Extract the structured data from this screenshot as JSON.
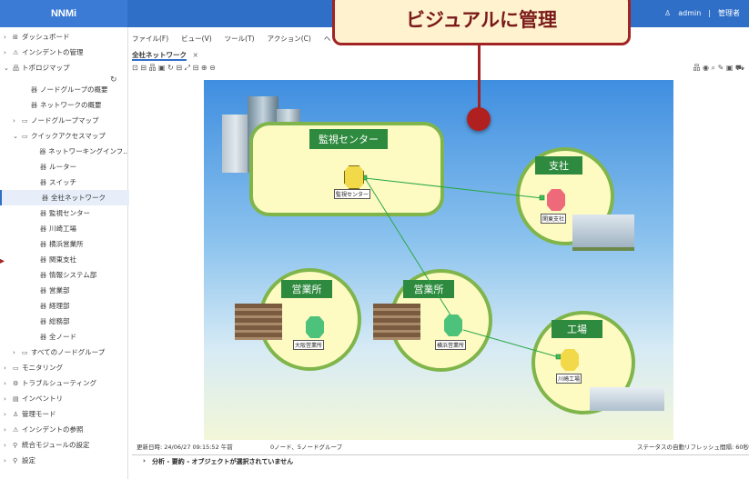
{
  "header": {
    "brand": "NNMi",
    "user": "admin",
    "separator": "|",
    "role": "管理者"
  },
  "sidebar": {
    "items": [
      {
        "chev": "›",
        "icon": "⊞",
        "label": "ダッシュボード"
      },
      {
        "chev": "›",
        "icon": "⚠",
        "label": "インシデントの管理"
      },
      {
        "chev": "⌄",
        "icon": "品",
        "label": "トポロジマップ"
      },
      {
        "chev": "",
        "icon": "器",
        "label": "ノードグループの概要"
      },
      {
        "chev": "",
        "icon": "器",
        "label": "ネットワークの概要"
      },
      {
        "chev": "›",
        "icon": "▭",
        "label": "ノードグループマップ"
      },
      {
        "chev": "⌄",
        "icon": "▭",
        "label": "クイックアクセスマップ"
      },
      {
        "chev": "",
        "icon": "器",
        "label": "ネットワーキングインフ.."
      },
      {
        "chev": "",
        "icon": "器",
        "label": "ルーター"
      },
      {
        "chev": "",
        "icon": "器",
        "label": "スイッチ"
      },
      {
        "chev": "",
        "icon": "器",
        "label": "全社ネットワーク"
      },
      {
        "chev": "",
        "icon": "器",
        "label": "監視センター"
      },
      {
        "chev": "",
        "icon": "器",
        "label": "川崎工場"
      },
      {
        "chev": "",
        "icon": "器",
        "label": "横浜営業所"
      },
      {
        "chev": "",
        "icon": "器",
        "label": "関東支社"
      },
      {
        "chev": "",
        "icon": "器",
        "label": "情報システム部"
      },
      {
        "chev": "",
        "icon": "器",
        "label": "営業部"
      },
      {
        "chev": "",
        "icon": "器",
        "label": "経理部"
      },
      {
        "chev": "",
        "icon": "器",
        "label": "総務部"
      },
      {
        "chev": "",
        "icon": "器",
        "label": "全ノード"
      },
      {
        "chev": "›",
        "icon": "▭",
        "label": "すべてのノードグループ"
      },
      {
        "chev": "›",
        "icon": "▭",
        "label": "モニタリング"
      },
      {
        "chev": "›",
        "icon": "⚙",
        "label": "トラブルシューティング"
      },
      {
        "chev": "›",
        "icon": "▤",
        "label": "インベントリ"
      },
      {
        "chev": "›",
        "icon": "♙",
        "label": "管理モード"
      },
      {
        "chev": "›",
        "icon": "⚠",
        "label": "インシデントの参照"
      },
      {
        "chev": "›",
        "icon": "⚲",
        "label": "統合モジュールの設定"
      },
      {
        "chev": "›",
        "icon": "⚲",
        "label": "設定"
      }
    ],
    "refresh_icon": "refresh-icon"
  },
  "menu": [
    "ファイル(F)",
    "ビュー(V)",
    "ツール(T)",
    "アクション(C)",
    "ヘ"
  ],
  "tab": {
    "label": "全社ネットワーク",
    "close": "×"
  },
  "toolbar": {
    "left": "⊡ ⊟ 品 ▣ ↻ ⊟ ⤢ ⊟ ⊕ ⊖",
    "right": "品 ◉ ⌕ ✎ ▣ ⛟"
  },
  "map": {
    "zones": {
      "center": "監視センター",
      "branch": "支社",
      "sales1": "営業所",
      "sales2": "営業所",
      "factory": "工場"
    },
    "nodes": {
      "center": "監視センター",
      "branch": "関東支社",
      "osaka": "大阪営業所",
      "yokohama": "横浜営業所",
      "kawasaki": "川崎工場"
    },
    "colors": {
      "zone_fill": "#fdfac2",
      "zone_border": "#7fb54b",
      "label_bg": "#2e8a3e",
      "link": "#2aa845",
      "node_yellow": "#f2d94a",
      "node_red": "#ee6a7a",
      "node_green": "#4cc27a"
    }
  },
  "status": {
    "updated": "更新日時: 24/06/27 09:15:52 午前",
    "counts": "0ノード、5ノードグループ",
    "refresh": "ステータスの自動リフレッシュ間隔: 60秒"
  },
  "detail": {
    "text": "分析 - 要約 - オブジェクトが選択されていません"
  },
  "callout": {
    "text": "ビジュアルに管理",
    "color": "#a12323"
  }
}
